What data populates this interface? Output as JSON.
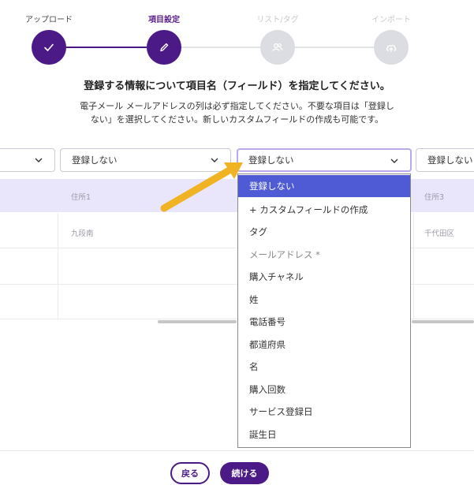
{
  "stepper": {
    "steps": [
      {
        "label": "アップロード",
        "state": "done",
        "icon": "check-icon"
      },
      {
        "label": "項目設定",
        "state": "current",
        "icon": "pencil-icon"
      },
      {
        "label": "リスト/タグ",
        "state": "pending",
        "icon": "users-icon"
      },
      {
        "label": "インポート",
        "state": "pending",
        "icon": "cloud-upload-icon"
      }
    ]
  },
  "heading": {
    "title": "登録する情報について項目名（フィールド）を指定してください。",
    "desc_line1": "電子メール メールアドレスの列は必ず指定してください。不要な項目は「登録し",
    "desc_line2": "ない」を選択してください。新しいカスタムフィールドの作成も可能です。"
  },
  "columns": {
    "selects": [
      "登録しない",
      "登録しない",
      "登録しない"
    ],
    "headers": [
      "住所1",
      "住所3"
    ],
    "cells": [
      "九段南",
      "千代田区"
    ]
  },
  "dropdown": {
    "options": [
      "登録しない",
      "+ カスタムフィールドの作成",
      "タグ",
      "メールアドレス *",
      "購入チャネル",
      "姓",
      "電話番号",
      "都道府県",
      "名",
      "購入回数",
      "サービス登録日",
      "誕生日"
    ],
    "selected_index": 0
  },
  "footer": {
    "back_label": "戻る",
    "next_label": "続ける"
  },
  "colors": {
    "brand": "#4b1a86",
    "selected_option": "#4f5bd5",
    "header_band": "#e9e6fb",
    "arrow": "#f0b323"
  }
}
